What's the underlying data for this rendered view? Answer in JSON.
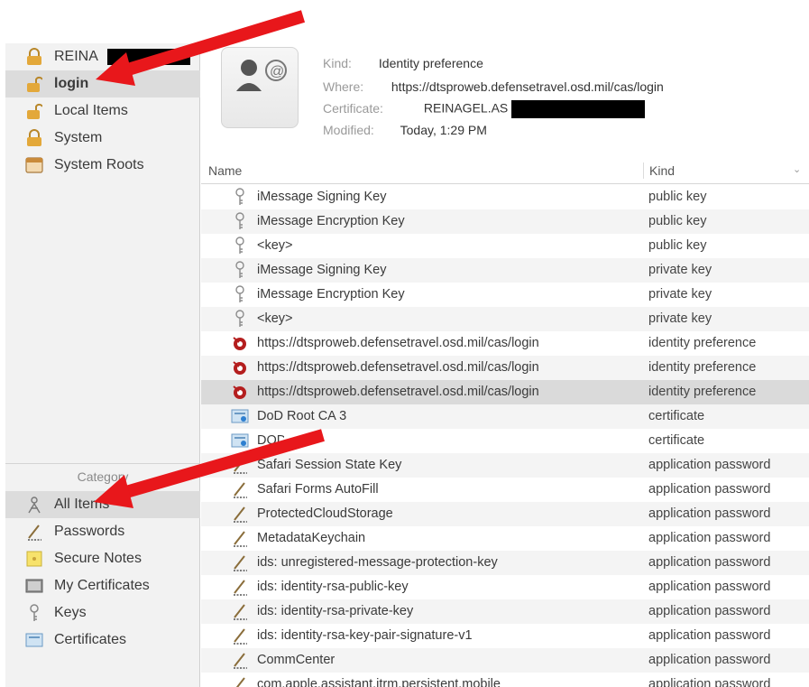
{
  "sidebar": {
    "keychains": [
      {
        "label": "REINA",
        "icon": "lock-icon",
        "selected": false
      },
      {
        "label": "login",
        "icon": "unlocked-icon",
        "selected": true
      },
      {
        "label": "Local Items",
        "icon": "unlocked-icon",
        "selected": false
      },
      {
        "label": "System",
        "icon": "lock-icon",
        "selected": false
      },
      {
        "label": "System Roots",
        "icon": "cabinet-icon",
        "selected": false
      }
    ],
    "category_header": "Category",
    "categories": [
      {
        "label": "All Items",
        "icon": "all-items-icon",
        "selected": true
      },
      {
        "label": "Passwords",
        "icon": "pen-icon",
        "selected": false
      },
      {
        "label": "Secure Notes",
        "icon": "note-icon",
        "selected": false
      },
      {
        "label": "My Certificates",
        "icon": "my-cert-icon",
        "selected": false
      },
      {
        "label": "Keys",
        "icon": "key-icon",
        "selected": false
      },
      {
        "label": "Certificates",
        "icon": "certificate-icon",
        "selected": false
      }
    ]
  },
  "info": {
    "kind_label": "Kind:",
    "kind_value": "Identity preference",
    "where_label": "Where:",
    "where_value": "https://dtsproweb.defensetravel.osd.mil/cas/login",
    "certificate_label": "Certificate:",
    "certificate_value": "REINAGEL.AS",
    "modified_label": "Modified:",
    "modified_value": "Today, 1:29 PM"
  },
  "table": {
    "col_name": "Name",
    "col_kind": "Kind",
    "rows": [
      {
        "name": "iMessage Signing Key",
        "kind": "public key",
        "icon": "key-icon"
      },
      {
        "name": "iMessage Encryption Key",
        "kind": "public key",
        "icon": "key-icon"
      },
      {
        "name": "<key>",
        "kind": "public key",
        "icon": "key-icon"
      },
      {
        "name": "iMessage Signing Key",
        "kind": "private key",
        "icon": "key-icon"
      },
      {
        "name": "iMessage Encryption Key",
        "kind": "private key",
        "icon": "key-icon"
      },
      {
        "name": "<key>",
        "kind": "private key",
        "icon": "key-icon"
      },
      {
        "name": "https://dtsproweb.defensetravel.osd.mil/cas/login",
        "kind": "identity preference",
        "icon": "identity-icon"
      },
      {
        "name": "https://dtsproweb.defensetravel.osd.mil/cas/login",
        "kind": "identity preference",
        "icon": "identity-icon"
      },
      {
        "name": "https://dtsproweb.defensetravel.osd.mil/cas/login",
        "kind": "identity preference",
        "icon": "identity-icon"
      },
      {
        "name": "DoD Root CA 3",
        "kind": "certificate",
        "icon": "certificate-icon"
      },
      {
        "name": "DOD        A-41",
        "kind": "certificate",
        "icon": "certificate-icon"
      },
      {
        "name": "Safari Session State Key",
        "kind": "application password",
        "icon": "pen-icon"
      },
      {
        "name": "Safari Forms AutoFill",
        "kind": "application password",
        "icon": "pen-icon"
      },
      {
        "name": "ProtectedCloudStorage",
        "kind": "application password",
        "icon": "pen-icon"
      },
      {
        "name": "MetadataKeychain",
        "kind": "application password",
        "icon": "pen-icon"
      },
      {
        "name": "ids: unregistered-message-protection-key",
        "kind": "application password",
        "icon": "pen-icon"
      },
      {
        "name": "ids: identity-rsa-public-key",
        "kind": "application password",
        "icon": "pen-icon"
      },
      {
        "name": "ids: identity-rsa-private-key",
        "kind": "application password",
        "icon": "pen-icon"
      },
      {
        "name": "ids: identity-rsa-key-pair-signature-v1",
        "kind": "application password",
        "icon": "pen-icon"
      },
      {
        "name": "CommCenter",
        "kind": "application password",
        "icon": "pen-icon"
      },
      {
        "name": "com.apple.assistant.itrm.persistent.mobile",
        "kind": "application password",
        "icon": "pen-icon"
      }
    ]
  },
  "colors": {
    "arrow": "#e8171b",
    "selection": "#dcdcdc",
    "sidebar_bg": "#f2f2f2"
  }
}
